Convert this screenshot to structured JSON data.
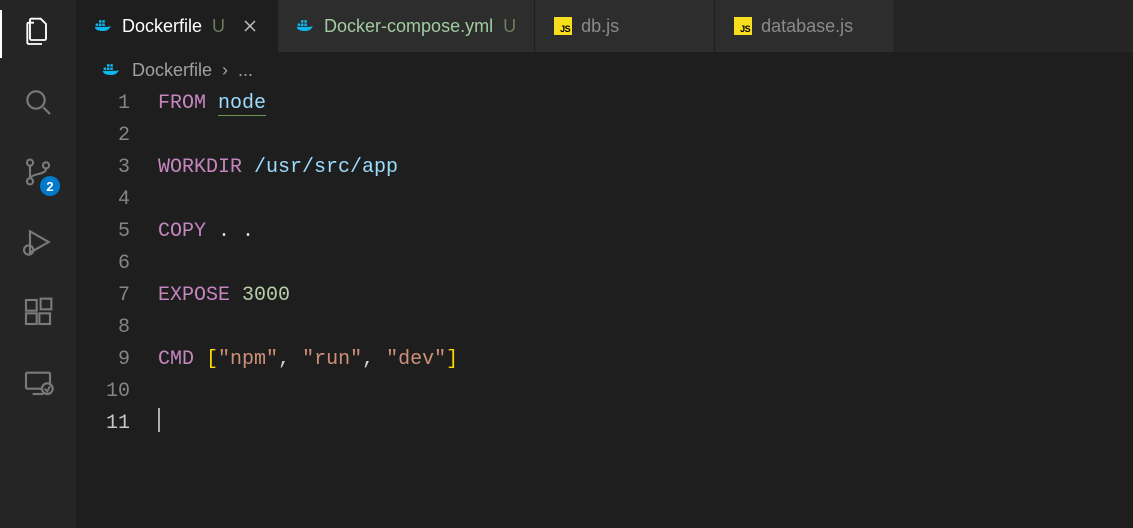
{
  "activity": {
    "scm_badge": "2"
  },
  "tabs": [
    {
      "label": "Dockerfile",
      "modified": "U",
      "icon": "docker",
      "active": true,
      "close": true
    },
    {
      "label": "Docker-compose.yml",
      "modified": "U",
      "icon": "docker",
      "active": false,
      "close": false
    },
    {
      "label": "db.js",
      "modified": "",
      "icon": "js",
      "active": false,
      "close": false
    },
    {
      "label": "database.js",
      "modified": "",
      "icon": "js",
      "active": false,
      "close": false
    }
  ],
  "breadcrumb": {
    "file": "Dockerfile",
    "sep": "›",
    "tail": "..."
  },
  "code": {
    "lines": [
      {
        "n": "1",
        "tokens": [
          {
            "t": "FROM",
            "c": "kw"
          },
          {
            "t": " ",
            "c": "op"
          },
          {
            "t": "node",
            "c": "id warn"
          }
        ]
      },
      {
        "n": "2",
        "tokens": []
      },
      {
        "n": "3",
        "tokens": [
          {
            "t": "WORKDIR",
            "c": "kw"
          },
          {
            "t": " ",
            "c": "op"
          },
          {
            "t": "/usr/src/app",
            "c": "id"
          }
        ]
      },
      {
        "n": "4",
        "tokens": []
      },
      {
        "n": "5",
        "tokens": [
          {
            "t": "COPY",
            "c": "kw"
          },
          {
            "t": " . .",
            "c": "op"
          }
        ]
      },
      {
        "n": "6",
        "tokens": []
      },
      {
        "n": "7",
        "tokens": [
          {
            "t": "EXPOSE",
            "c": "kw"
          },
          {
            "t": " ",
            "c": "op"
          },
          {
            "t": "3000",
            "c": "num"
          }
        ]
      },
      {
        "n": "8",
        "tokens": []
      },
      {
        "n": "9",
        "tokens": [
          {
            "t": "CMD",
            "c": "kw"
          },
          {
            "t": " ",
            "c": "op"
          },
          {
            "t": "[",
            "c": "pun"
          },
          {
            "t": "\"npm\"",
            "c": "str"
          },
          {
            "t": ", ",
            "c": "op"
          },
          {
            "t": "\"run\"",
            "c": "str"
          },
          {
            "t": ", ",
            "c": "op"
          },
          {
            "t": "\"dev\"",
            "c": "str"
          },
          {
            "t": "]",
            "c": "pun"
          }
        ]
      },
      {
        "n": "10",
        "tokens": []
      },
      {
        "n": "11",
        "tokens": [],
        "current": true,
        "cursor": true
      }
    ]
  }
}
